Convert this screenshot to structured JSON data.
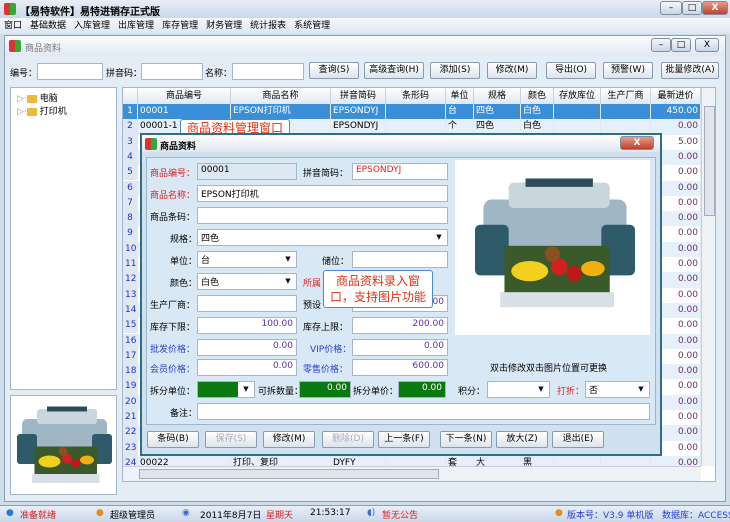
{
  "app": {
    "title": "【易特软件】易特进销存正式版",
    "min": "–",
    "max": "□",
    "close": "X"
  },
  "menu": [
    "窗口",
    "基础数据",
    "入库管理",
    "出库管理",
    "库存管理",
    "财务管理",
    "统计报表",
    "系统管理"
  ],
  "inner": {
    "title": "商品资料"
  },
  "search": {
    "code_label": "编号：",
    "code": "",
    "pinyin_label": "拼音码：",
    "pinyin": "",
    "name_label": "名称：",
    "name": "",
    "buttons": [
      "查询(S)",
      "高级查询(H)",
      "添加(S)",
      "修改(M)",
      "导出(O)",
      "预警(W)",
      "批量修改(A)"
    ]
  },
  "tree": [
    {
      "label": "电脑"
    },
    {
      "label": "打印机"
    }
  ],
  "grid": {
    "columns": [
      "商品编号",
      "商品名称",
      "拼音简码",
      "条形码",
      "单位",
      "规格",
      "颜色",
      "存放库位",
      "生产厂商",
      "最新进价"
    ],
    "rows": [
      [
        "1",
        "00001",
        "EPSON打印机",
        "EPSONDYJ",
        "",
        "台",
        "四色",
        "白色",
        "",
        "",
        "450.00"
      ],
      [
        "2",
        "00001-1",
        "",
        "EPSONDYJ",
        "",
        "个",
        "四色",
        "白色",
        "",
        "",
        "0.00"
      ],
      [
        "3",
        "",
        "",
        "",
        "",
        "",
        "",
        "",
        "",
        "",
        "5.00"
      ],
      [
        "4",
        "",
        "",
        "",
        "",
        "",
        "",
        "",
        "",
        "",
        "0.00"
      ],
      [
        "5",
        "",
        "",
        "",
        "",
        "",
        "",
        "",
        "",
        "",
        "0.00"
      ],
      [
        "6",
        "",
        "",
        "",
        "",
        "",
        "",
        "",
        "",
        "",
        "0.00"
      ],
      [
        "7",
        "",
        "",
        "",
        "",
        "",
        "",
        "",
        "",
        "",
        "0.00"
      ],
      [
        "8",
        "",
        "",
        "",
        "",
        "",
        "",
        "",
        "",
        "",
        "0.00"
      ],
      [
        "9",
        "",
        "",
        "",
        "",
        "",
        "",
        "",
        "",
        "",
        "0.00"
      ],
      [
        "10",
        "",
        "",
        "",
        "",
        "",
        "",
        "",
        "",
        "",
        "0.00"
      ],
      [
        "11",
        "",
        "",
        "",
        "",
        "",
        "",
        "",
        "",
        "",
        "0.00"
      ],
      [
        "12",
        "",
        "",
        "",
        "",
        "",
        "",
        "",
        "",
        "",
        "0.00"
      ],
      [
        "13",
        "",
        "",
        "",
        "",
        "",
        "",
        "",
        "",
        "",
        "0.00"
      ],
      [
        "14",
        "",
        "",
        "",
        "",
        "",
        "",
        "",
        "",
        "",
        "0.00"
      ],
      [
        "15",
        "",
        "",
        "",
        "",
        "",
        "",
        "",
        "",
        "",
        "0.00"
      ],
      [
        "16",
        "",
        "",
        "",
        "",
        "",
        "",
        "",
        "",
        "",
        "0.00"
      ],
      [
        "17",
        "",
        "",
        "",
        "",
        "",
        "",
        "",
        "",
        "",
        "0.00"
      ],
      [
        "18",
        "",
        "",
        "",
        "",
        "",
        "",
        "",
        "",
        "",
        "0.00"
      ],
      [
        "19",
        "",
        "",
        "",
        "",
        "",
        "",
        "",
        "",
        "",
        "0.00"
      ],
      [
        "20",
        "",
        "",
        "",
        "",
        "",
        "",
        "",
        "",
        "",
        "0.00"
      ],
      [
        "21",
        "",
        "",
        "",
        "",
        "",
        "",
        "",
        "",
        "",
        "0.00"
      ],
      [
        "22",
        "",
        "",
        "",
        "",
        "",
        "",
        "",
        "",
        "",
        "0.00"
      ],
      [
        "23",
        "",
        "",
        "",
        "",
        "",
        "",
        "",
        "",
        "",
        "0.00"
      ],
      [
        "24",
        "00022",
        "打印、复印",
        "DYFY",
        "",
        "套",
        "大",
        "黑",
        "",
        "",
        "0.00"
      ]
    ],
    "selected_row": 1
  },
  "dialog": {
    "title": "商品资料",
    "code_label": "商品编号：",
    "code": "00001",
    "pinyin_label": "拼音简码：",
    "pinyin": "EPSONDYJ",
    "name_label": "商品名称：",
    "name": "EPSON打印机",
    "barcode_label": "商品条码：",
    "barcode": "",
    "spec_label": "规格：",
    "spec": "四色",
    "unit_label": "单位：",
    "unit": "台",
    "loc_label": "储位：",
    "loc": "",
    "color_label": "颜色：",
    "color": "白色",
    "cat_label": "所属",
    "maker_label": "生产厂商：",
    "maker": "",
    "preset_label": "预设",
    "preset": ".00",
    "min_label": "库存下限：",
    "min": "100.00",
    "max_label": "库存上限：",
    "max": "200.00",
    "wholesale_label": "批发价格：",
    "wholesale": "0.00",
    "vip_label": "VIP价格：",
    "vip": "0.00",
    "member_label": "会员价格：",
    "member": "0.00",
    "retail_label": "零售价格：",
    "retail": "600.00",
    "split_unit_label": "拆分单位：",
    "split_qty_label": "可拆数量：",
    "split_qty": "0.00",
    "split_price_label": "拆分单价：",
    "split_price": "0.00",
    "image_caption": "双击修改双击图片位置可更换",
    "points_label": "积分：",
    "points": "",
    "discount_label": "打折：",
    "discount": "否",
    "remark_label": "备注：",
    "remark": "",
    "buttons": [
      "条码(B)",
      "保存(S)",
      "修改(M)",
      "删除(D)",
      "上一条(F)",
      "下一条(N)",
      "放大(Z)",
      "退出(E)"
    ]
  },
  "tips": {
    "grid": "商品资料管理窗口",
    "dialog_line1": "商品资料录入窗",
    "dialog_line2": "口，支持图片功能"
  },
  "status": {
    "ready": "准备就绪",
    "user": "超级管理员",
    "date": "2011年8月7日",
    "weekday": "星期天",
    "time": "21:53:17",
    "notice": "暂无公告",
    "version": "版本号：V3.9 单机版",
    "db": "数据库：ACCESS"
  }
}
